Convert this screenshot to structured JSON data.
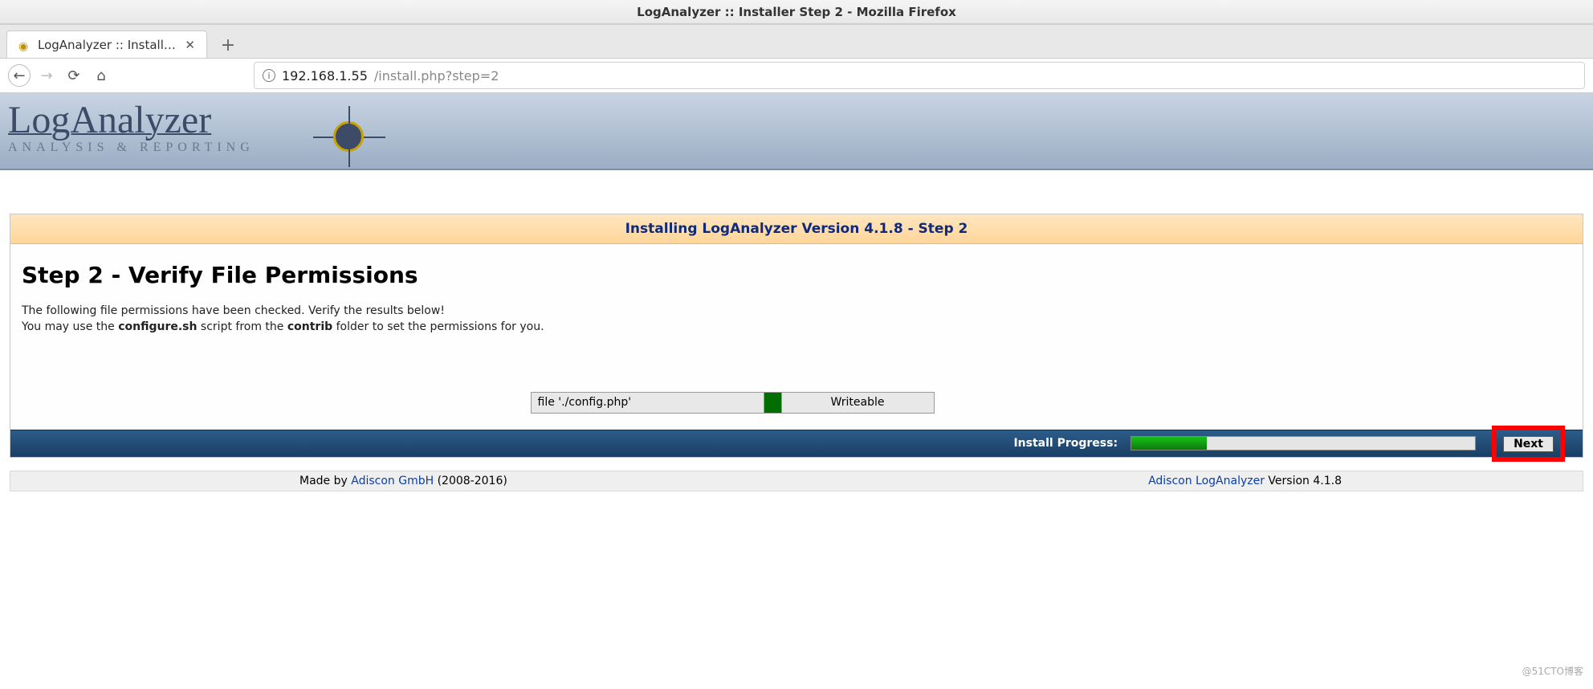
{
  "window": {
    "title": "LogAnalyzer :: Installer Step 2 - Mozilla Firefox"
  },
  "tab": {
    "title": "LogAnalyzer :: Installer St"
  },
  "url": {
    "host": "192.168.1.55",
    "path": "/install.php?step=2"
  },
  "logo": {
    "brand": "LogAnalyzer",
    "tagline": "ANALYSIS & REPORTING"
  },
  "panel": {
    "header": "Installing LogAnalyzer Version 4.1.8 - Step 2",
    "title": "Step 2 - Verify File Permissions",
    "desc_line1": "The following file permissions have been checked. Verify the results below!",
    "desc_line2_a": "You may use the ",
    "desc_line2_b": "configure.sh",
    "desc_line2_c": " script from the ",
    "desc_line2_d": "contrib",
    "desc_line2_e": " folder to set the permissions for you."
  },
  "filecheck": {
    "file": "file './config.php'",
    "status": "Writeable"
  },
  "progress": {
    "label": "Install Progress:",
    "percent": 22,
    "next": "Next"
  },
  "footer": {
    "made_by_prefix": "Made by ",
    "made_by_link": "Adiscon GmbH",
    "made_by_suffix": " (2008-2016)",
    "right_link": "Adiscon LogAnalyzer",
    "right_suffix": " Version 4.1.8"
  },
  "watermark": "@51CTO博客"
}
